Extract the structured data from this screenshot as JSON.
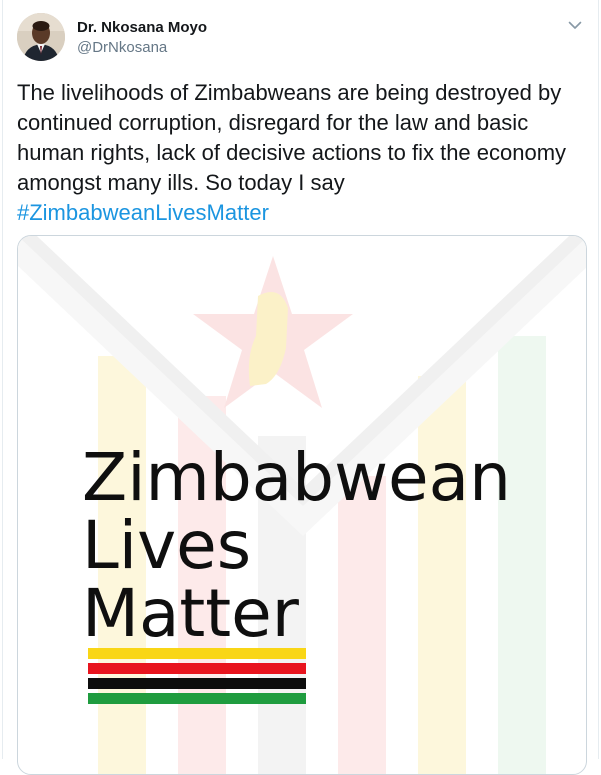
{
  "user": {
    "display_name": "Dr. Nkosana Moyo",
    "handle": "@DrNkosana"
  },
  "icons": {
    "caret": "chevron-down-icon",
    "avatar": "profile-photo"
  },
  "tweet": {
    "text": "The livelihoods of Zimbabweans are being destroyed by continued corruption, disregard for the law and basic human rights, lack of decisive actions to fix the economy amongst many ills. So today I say",
    "hashtag": "#ZimbabweanLivesMatter"
  },
  "media": {
    "line1": "Zimbabwean",
    "line2": "Lives",
    "line3": "Matter",
    "stripe_colors": [
      "#f9d616",
      "#e8141e",
      "#0d0d0d",
      "#1f9c3f"
    ]
  },
  "colors": {
    "link": "#1b95e0",
    "secondary_text": "#657786",
    "border": "#e6ecf0"
  }
}
